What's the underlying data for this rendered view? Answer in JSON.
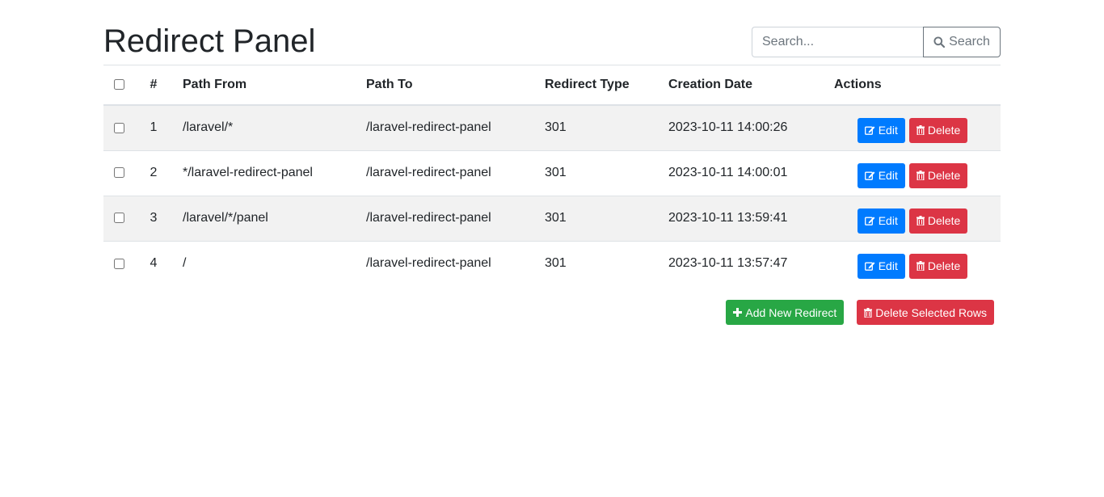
{
  "header": {
    "title": "Redirect Panel"
  },
  "search": {
    "placeholder": "Search...",
    "value": "",
    "button_label": "Search",
    "icon": "search-icon"
  },
  "table": {
    "columns": {
      "select": "",
      "number": "#",
      "path_from": "Path From",
      "path_to": "Path To",
      "redirect_type": "Redirect Type",
      "creation_date": "Creation Date",
      "actions": "Actions"
    },
    "rows": [
      {
        "number": "1",
        "path_from": "/laravel/*",
        "path_to": "/laravel-redirect-panel",
        "redirect_type": "301",
        "creation_date": "2023-10-11 14:00:26",
        "edit_label": "Edit",
        "delete_label": "Delete",
        "checked": false
      },
      {
        "number": "2",
        "path_from": "*/laravel-redirect-panel",
        "path_to": "/laravel-redirect-panel",
        "redirect_type": "301",
        "creation_date": "2023-10-11 14:00:01",
        "edit_label": "Edit",
        "delete_label": "Delete",
        "checked": false
      },
      {
        "number": "3",
        "path_from": "/laravel/*/panel",
        "path_to": "/laravel-redirect-panel",
        "redirect_type": "301",
        "creation_date": "2023-10-11 13:59:41",
        "edit_label": "Edit",
        "delete_label": "Delete",
        "checked": false
      },
      {
        "number": "4",
        "path_from": "/",
        "path_to": "/laravel-redirect-panel",
        "redirect_type": "301",
        "creation_date": "2023-10-11 13:57:47",
        "edit_label": "Edit",
        "delete_label": "Delete",
        "checked": false
      }
    ]
  },
  "footer": {
    "add_label": "Add New Redirect",
    "delete_selected_label": "Delete Selected Rows"
  },
  "colors": {
    "primary": "#007bff",
    "danger": "#dc3545",
    "success": "#28a745",
    "secondary": "#6c757d",
    "stripe": "#f2f2f2"
  }
}
